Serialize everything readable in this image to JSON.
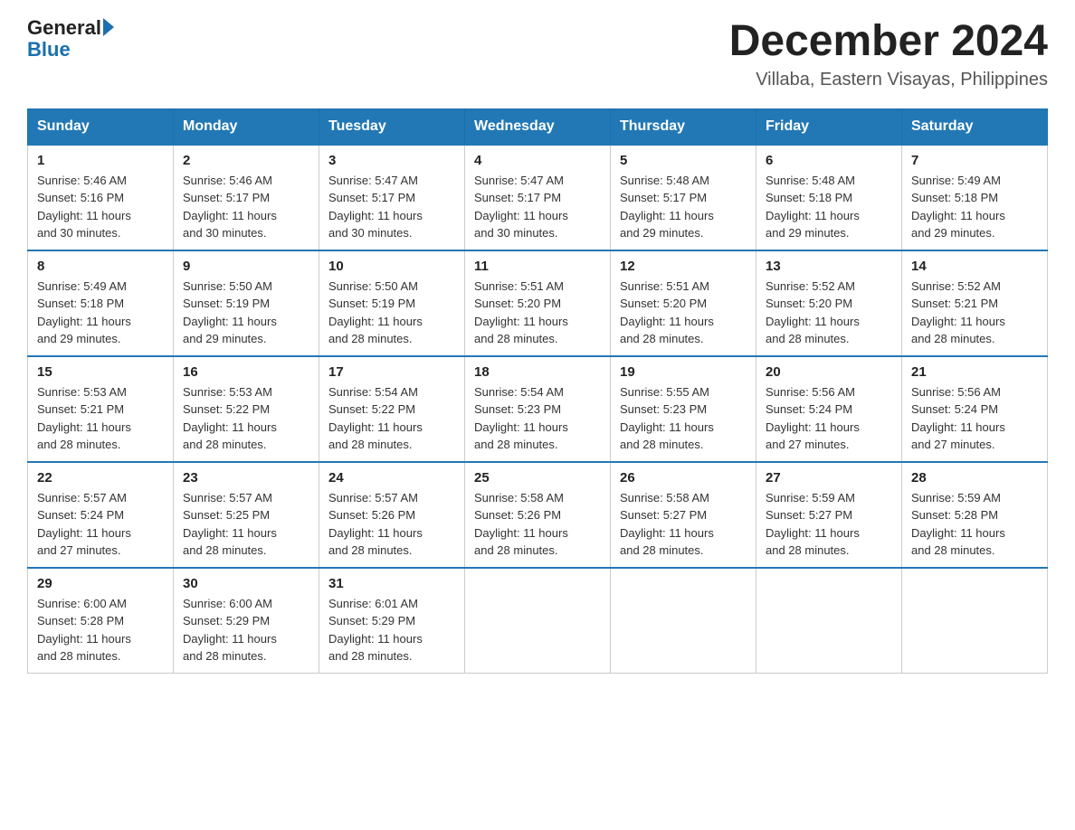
{
  "header": {
    "logo_general": "General",
    "logo_blue": "Blue",
    "month_year": "December 2024",
    "location": "Villaba, Eastern Visayas, Philippines"
  },
  "weekdays": [
    "Sunday",
    "Monday",
    "Tuesday",
    "Wednesday",
    "Thursday",
    "Friday",
    "Saturday"
  ],
  "weeks": [
    [
      {
        "day": "1",
        "sunrise": "5:46 AM",
        "sunset": "5:16 PM",
        "daylight": "11 hours and 30 minutes."
      },
      {
        "day": "2",
        "sunrise": "5:46 AM",
        "sunset": "5:17 PM",
        "daylight": "11 hours and 30 minutes."
      },
      {
        "day": "3",
        "sunrise": "5:47 AM",
        "sunset": "5:17 PM",
        "daylight": "11 hours and 30 minutes."
      },
      {
        "day": "4",
        "sunrise": "5:47 AM",
        "sunset": "5:17 PM",
        "daylight": "11 hours and 30 minutes."
      },
      {
        "day": "5",
        "sunrise": "5:48 AM",
        "sunset": "5:17 PM",
        "daylight": "11 hours and 29 minutes."
      },
      {
        "day": "6",
        "sunrise": "5:48 AM",
        "sunset": "5:18 PM",
        "daylight": "11 hours and 29 minutes."
      },
      {
        "day": "7",
        "sunrise": "5:49 AM",
        "sunset": "5:18 PM",
        "daylight": "11 hours and 29 minutes."
      }
    ],
    [
      {
        "day": "8",
        "sunrise": "5:49 AM",
        "sunset": "5:18 PM",
        "daylight": "11 hours and 29 minutes."
      },
      {
        "day": "9",
        "sunrise": "5:50 AM",
        "sunset": "5:19 PM",
        "daylight": "11 hours and 29 minutes."
      },
      {
        "day": "10",
        "sunrise": "5:50 AM",
        "sunset": "5:19 PM",
        "daylight": "11 hours and 28 minutes."
      },
      {
        "day": "11",
        "sunrise": "5:51 AM",
        "sunset": "5:20 PM",
        "daylight": "11 hours and 28 minutes."
      },
      {
        "day": "12",
        "sunrise": "5:51 AM",
        "sunset": "5:20 PM",
        "daylight": "11 hours and 28 minutes."
      },
      {
        "day": "13",
        "sunrise": "5:52 AM",
        "sunset": "5:20 PM",
        "daylight": "11 hours and 28 minutes."
      },
      {
        "day": "14",
        "sunrise": "5:52 AM",
        "sunset": "5:21 PM",
        "daylight": "11 hours and 28 minutes."
      }
    ],
    [
      {
        "day": "15",
        "sunrise": "5:53 AM",
        "sunset": "5:21 PM",
        "daylight": "11 hours and 28 minutes."
      },
      {
        "day": "16",
        "sunrise": "5:53 AM",
        "sunset": "5:22 PM",
        "daylight": "11 hours and 28 minutes."
      },
      {
        "day": "17",
        "sunrise": "5:54 AM",
        "sunset": "5:22 PM",
        "daylight": "11 hours and 28 minutes."
      },
      {
        "day": "18",
        "sunrise": "5:54 AM",
        "sunset": "5:23 PM",
        "daylight": "11 hours and 28 minutes."
      },
      {
        "day": "19",
        "sunrise": "5:55 AM",
        "sunset": "5:23 PM",
        "daylight": "11 hours and 28 minutes."
      },
      {
        "day": "20",
        "sunrise": "5:56 AM",
        "sunset": "5:24 PM",
        "daylight": "11 hours and 27 minutes."
      },
      {
        "day": "21",
        "sunrise": "5:56 AM",
        "sunset": "5:24 PM",
        "daylight": "11 hours and 27 minutes."
      }
    ],
    [
      {
        "day": "22",
        "sunrise": "5:57 AM",
        "sunset": "5:24 PM",
        "daylight": "11 hours and 27 minutes."
      },
      {
        "day": "23",
        "sunrise": "5:57 AM",
        "sunset": "5:25 PM",
        "daylight": "11 hours and 28 minutes."
      },
      {
        "day": "24",
        "sunrise": "5:57 AM",
        "sunset": "5:26 PM",
        "daylight": "11 hours and 28 minutes."
      },
      {
        "day": "25",
        "sunrise": "5:58 AM",
        "sunset": "5:26 PM",
        "daylight": "11 hours and 28 minutes."
      },
      {
        "day": "26",
        "sunrise": "5:58 AM",
        "sunset": "5:27 PM",
        "daylight": "11 hours and 28 minutes."
      },
      {
        "day": "27",
        "sunrise": "5:59 AM",
        "sunset": "5:27 PM",
        "daylight": "11 hours and 28 minutes."
      },
      {
        "day": "28",
        "sunrise": "5:59 AM",
        "sunset": "5:28 PM",
        "daylight": "11 hours and 28 minutes."
      }
    ],
    [
      {
        "day": "29",
        "sunrise": "6:00 AM",
        "sunset": "5:28 PM",
        "daylight": "11 hours and 28 minutes."
      },
      {
        "day": "30",
        "sunrise": "6:00 AM",
        "sunset": "5:29 PM",
        "daylight": "11 hours and 28 minutes."
      },
      {
        "day": "31",
        "sunrise": "6:01 AM",
        "sunset": "5:29 PM",
        "daylight": "11 hours and 28 minutes."
      },
      null,
      null,
      null,
      null
    ]
  ],
  "labels": {
    "sunrise": "Sunrise:",
    "sunset": "Sunset:",
    "daylight": "Daylight:"
  }
}
